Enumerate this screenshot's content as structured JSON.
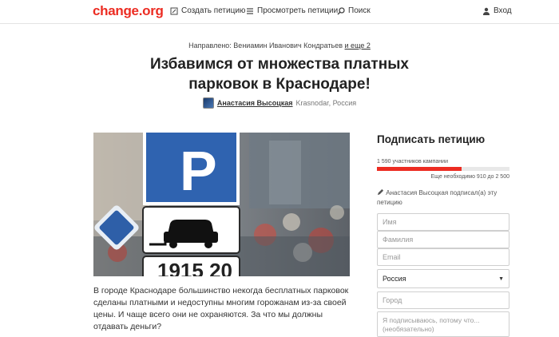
{
  "header": {
    "logo": "change.org",
    "create_label": "Создать петицию",
    "browse_label": "Просмотреть петиции",
    "search_label": "Поиск",
    "login_label": "Вход"
  },
  "petition": {
    "sent_to_prefix": "Направлено: Вениамин Иванович Кондратьев",
    "sent_to_more": "и еще 2",
    "title": "Избавимся от множества платных парковок в Краснодаре!",
    "author": "Анастасия Высоцкая",
    "location": "Krasnodar, Россия",
    "description": "В городе Краснодаре большинство некогда бесплатных парковок сделаны платными и недоступны многим горожанам из-за своей цены. И чаще всего они не охраняются. За что мы должны отдавать деньги?"
  },
  "hero": {
    "sign_top": "P",
    "plate_text": "1915 20"
  },
  "sidebar": {
    "title": "Подписать петицию",
    "count": "1 590 участников кампании",
    "progress_fraction": 0.636,
    "needed": "Еще необходимо 910 до 2 500",
    "signed_note": "Анастасия Высоцкая подписал(а) эту петицию",
    "first_name_placeholder": "Имя",
    "last_name_placeholder": "Фамилия",
    "email_placeholder": "Email",
    "country": "Россия",
    "city_placeholder": "Город",
    "reason_placeholder": "Я подписываюсь, потому что... (необязательно)"
  },
  "colors": {
    "brand": "#ec2c22"
  }
}
